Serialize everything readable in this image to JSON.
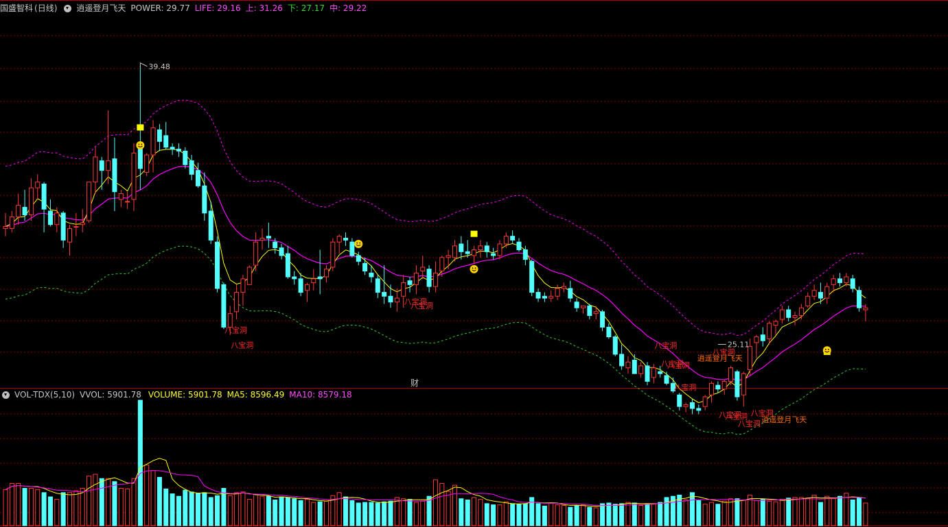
{
  "header": {
    "stock_name": "国盛智科",
    "period": "(日线)",
    "indicator_name": "逍遥登月飞天",
    "power": "POWER: 29.77",
    "life": "LIFE: 29.16",
    "upper": "上: 31.26",
    "lower": "下: 27.17",
    "mid": "中: 29.22"
  },
  "vol_header": {
    "name": "VOL-TDX(5,10)",
    "vvol": "VVOL: 5901.78",
    "volume": "VOLUME: 5901.78",
    "ma5": "MA5: 8596.49",
    "ma10": "MA10: 8579.18"
  },
  "colors": {
    "up": "#ff3a3a",
    "down": "#54ffff",
    "yellow": "#ffff00",
    "magenta": "#ff00ff",
    "green_band": "#33cc33",
    "grid": "#8b0000",
    "header_gray": "#c8c8c8"
  },
  "annotations": {
    "high_label": "39.48",
    "low_label": "25.11",
    "cai_label": "财",
    "signal_a": "八宝洞",
    "signal_b": "逍遥登月飞天"
  },
  "chart_data": {
    "type": "candlestick",
    "price_range": [
      23.5,
      42.2
    ],
    "volume_range": [
      0,
      20500
    ],
    "candles": [
      [
        31.1,
        31.9,
        30.7,
        31.2,
        5900
      ],
      [
        31.1,
        32.0,
        30.9,
        31.7,
        6900
      ],
      [
        31.7,
        32.9,
        31.3,
        32.3,
        6900
      ],
      [
        32.2,
        33.1,
        31.5,
        31.8,
        6100
      ],
      [
        31.8,
        33.7,
        31.5,
        33.2,
        6100
      ],
      [
        33.2,
        33.9,
        32.6,
        33.5,
        5900
      ],
      [
        33.4,
        33.5,
        30.9,
        32.1,
        5400
      ],
      [
        32.0,
        32.6,
        31.2,
        31.3,
        4700
      ],
      [
        31.3,
        32.2,
        30.9,
        31.9,
        4300
      ],
      [
        31.9,
        32.0,
        30.1,
        30.5,
        5400
      ],
      [
        30.4,
        31.3,
        29.7,
        31.1,
        5400
      ],
      [
        31.2,
        31.9,
        30.7,
        31.2,
        5700
      ],
      [
        31.3,
        32.1,
        30.9,
        31.4,
        6100
      ],
      [
        31.5,
        33.5,
        31.4,
        33.5,
        8100
      ],
      [
        33.5,
        35.3,
        32.9,
        34.8,
        8400
      ],
      [
        34.6,
        34.8,
        33.1,
        34.1,
        7700
      ],
      [
        34.1,
        37.2,
        33.4,
        34.6,
        7700
      ],
      [
        34.7,
        35.8,
        32.0,
        33.0,
        7200
      ],
      [
        32.6,
        33.1,
        32.2,
        32.9,
        6100
      ],
      [
        32.5,
        33.0,
        32.1,
        32.5,
        6000
      ],
      [
        32.6,
        35.5,
        32.0,
        35.0,
        7700
      ],
      [
        35.3,
        39.5,
        33.1,
        34.2,
        20500
      ],
      [
        34.0,
        35.0,
        33.8,
        34.9,
        9900
      ],
      [
        34.9,
        36.7,
        34.0,
        36.3,
        9000
      ],
      [
        36.2,
        36.5,
        35.1,
        35.6,
        7900
      ],
      [
        35.9,
        36.6,
        35.2,
        35.3,
        6000
      ],
      [
        35.3,
        35.5,
        34.9,
        35.2,
        5200
      ],
      [
        35.2,
        35.5,
        34.8,
        35.1,
        4800
      ],
      [
        35.1,
        35.3,
        34.2,
        34.4,
        5800
      ],
      [
        34.6,
        34.9,
        33.6,
        33.9,
        5500
      ],
      [
        34.1,
        34.5,
        33.2,
        33.3,
        5300
      ],
      [
        33.3,
        34.0,
        31.5,
        31.9,
        5400
      ],
      [
        32.0,
        32.5,
        30.3,
        30.5,
        4600
      ],
      [
        30.4,
        30.7,
        27.8,
        28.0,
        4900
      ],
      [
        28.2,
        28.3,
        25.9,
        26.0,
        6100
      ],
      [
        26.0,
        27.1,
        25.6,
        26.7,
        4900
      ],
      [
        26.8,
        28.2,
        26.4,
        27.8,
        5400
      ],
      [
        27.8,
        28.7,
        27.1,
        28.5,
        5500
      ],
      [
        28.2,
        29.2,
        28.2,
        29.1,
        4300
      ],
      [
        29.2,
        30.9,
        28.9,
        30.4,
        5100
      ],
      [
        30.5,
        31.1,
        30.0,
        30.6,
        4800
      ],
      [
        30.7,
        31.4,
        30.1,
        30.6,
        4800
      ],
      [
        30.4,
        30.6,
        29.8,
        30.1,
        4200
      ],
      [
        30.1,
        30.3,
        29.5,
        29.7,
        4700
      ],
      [
        29.8,
        30.2,
        28.5,
        28.6,
        4600
      ],
      [
        28.6,
        28.9,
        28.2,
        28.5,
        4400
      ],
      [
        28.5,
        28.8,
        27.6,
        27.8,
        4100
      ],
      [
        27.9,
        28.3,
        27.3,
        28.2,
        4300
      ],
      [
        28.3,
        29.0,
        27.9,
        28.5,
        3800
      ],
      [
        28.6,
        30.0,
        27.7,
        28.5,
        3900
      ],
      [
        28.6,
        29.2,
        28.3,
        29.0,
        4000
      ],
      [
        29.1,
        30.6,
        28.9,
        30.4,
        4900
      ],
      [
        30.4,
        30.8,
        29.8,
        30.7,
        5400
      ],
      [
        30.6,
        30.9,
        30.2,
        30.5,
        4700
      ],
      [
        30.4,
        30.6,
        29.6,
        29.7,
        4100
      ],
      [
        29.7,
        29.9,
        29.2,
        29.4,
        3700
      ],
      [
        29.3,
        29.6,
        28.7,
        28.9,
        3800
      ],
      [
        28.8,
        29.2,
        28.3,
        28.6,
        3800
      ],
      [
        28.5,
        28.7,
        27.5,
        27.8,
        3700
      ],
      [
        27.8,
        29.2,
        27.2,
        27.6,
        3900
      ],
      [
        27.6,
        28.2,
        27.0,
        27.3,
        4000
      ],
      [
        27.3,
        28.0,
        26.8,
        27.5,
        4600
      ],
      [
        27.6,
        28.7,
        27.0,
        28.3,
        4400
      ],
      [
        28.4,
        28.6,
        27.8,
        28.2,
        4300
      ],
      [
        28.2,
        29.2,
        27.7,
        28.8,
        3800
      ],
      [
        28.9,
        29.7,
        28.5,
        29.1,
        4000
      ],
      [
        29.0,
        29.2,
        27.8,
        28.1,
        4800
      ],
      [
        28.1,
        29.4,
        27.8,
        28.8,
        7500
      ],
      [
        28.9,
        29.7,
        28.6,
        29.6,
        6900
      ],
      [
        29.6,
        30.0,
        29.0,
        29.7,
        5600
      ],
      [
        29.6,
        30.5,
        29.4,
        30.2,
        6600
      ],
      [
        30.3,
        30.7,
        29.5,
        29.9,
        4400
      ],
      [
        29.9,
        30.5,
        29.6,
        29.8,
        4200
      ],
      [
        29.7,
        30.2,
        29.3,
        30.0,
        4600
      ],
      [
        30.0,
        30.5,
        29.6,
        30.2,
        4300
      ],
      [
        30.2,
        30.4,
        29.6,
        29.9,
        3600
      ],
      [
        29.8,
        30.1,
        29.5,
        29.7,
        3400
      ],
      [
        29.7,
        30.5,
        29.5,
        30.3,
        3400
      ],
      [
        30.3,
        30.9,
        30.1,
        30.7,
        3900
      ],
      [
        30.7,
        31.0,
        30.3,
        30.5,
        3600
      ],
      [
        30.4,
        30.6,
        29.9,
        30.0,
        3500
      ],
      [
        30.0,
        30.2,
        29.2,
        29.5,
        3600
      ],
      [
        29.4,
        29.5,
        27.6,
        27.8,
        4600
      ],
      [
        27.8,
        28.0,
        27.3,
        27.5,
        3600
      ],
      [
        27.6,
        27.8,
        27.3,
        27.5,
        3200
      ],
      [
        27.5,
        27.9,
        27.3,
        27.6,
        3700
      ],
      [
        27.6,
        28.2,
        27.4,
        28.0,
        3400
      ],
      [
        28.0,
        28.3,
        27.8,
        28.1,
        3300
      ],
      [
        28.0,
        28.4,
        27.3,
        27.5,
        3000
      ],
      [
        27.3,
        27.5,
        26.8,
        27.0,
        3300
      ],
      [
        27.0,
        27.1,
        26.7,
        27.1,
        3400
      ],
      [
        27.1,
        27.2,
        26.4,
        26.6,
        3000
      ],
      [
        26.7,
        27.1,
        26.4,
        26.8,
        2900
      ],
      [
        26.8,
        26.9,
        25.8,
        26.0,
        3600
      ],
      [
        26.0,
        26.2,
        25.4,
        25.5,
        3700
      ],
      [
        25.5,
        25.6,
        24.5,
        24.6,
        3500
      ],
      [
        24.6,
        25.1,
        23.8,
        24.0,
        3600
      ],
      [
        23.9,
        24.5,
        23.6,
        24.2,
        3800
      ],
      [
        24.3,
        24.6,
        23.6,
        23.6,
        3700
      ],
      [
        23.6,
        24.2,
        23.4,
        24.0,
        3300
      ],
      [
        24.0,
        24.2,
        23.0,
        23.2,
        3600
      ],
      [
        23.4,
        24.1,
        23.1,
        23.9,
        3500
      ],
      [
        23.7,
        24.0,
        23.4,
        23.6,
        3800
      ],
      [
        23.5,
        23.7,
        23.0,
        23.1,
        4600
      ],
      [
        23.1,
        23.4,
        22.6,
        22.7,
        4800
      ],
      [
        22.5,
        22.6,
        21.7,
        21.9,
        5000
      ],
      [
        21.9,
        22.1,
        21.6,
        22.0,
        4200
      ],
      [
        22.1,
        22.3,
        21.5,
        21.8,
        5400
      ],
      [
        21.8,
        22.0,
        21.5,
        21.7,
        4100
      ],
      [
        21.9,
        22.5,
        21.7,
        22.4,
        3500
      ],
      [
        22.5,
        23.2,
        22.1,
        23.1,
        3800
      ],
      [
        23.0,
        23.2,
        22.6,
        22.8,
        3500
      ],
      [
        22.8,
        23.3,
        22.5,
        23.2,
        4000
      ],
      [
        23.2,
        24.0,
        23.0,
        23.9,
        4400
      ],
      [
        23.7,
        23.8,
        22.2,
        22.4,
        4400
      ],
      [
        22.5,
        23.7,
        21.9,
        23.6,
        4200
      ],
      [
        23.8,
        25.4,
        23.5,
        25.0,
        5000
      ],
      [
        25.2,
        25.6,
        24.4,
        25.5,
        4100
      ],
      [
        25.6,
        26.0,
        25.0,
        25.3,
        4300
      ],
      [
        25.4,
        26.3,
        25.1,
        26.2,
        4000
      ],
      [
        26.1,
        26.4,
        25.6,
        26.3,
        3900
      ],
      [
        26.4,
        27.1,
        26.2,
        26.9,
        4300
      ],
      [
        26.9,
        27.1,
        26.3,
        26.5,
        4500
      ],
      [
        26.5,
        26.8,
        26.1,
        26.6,
        4600
      ],
      [
        26.6,
        27.2,
        26.4,
        27.0,
        4600
      ],
      [
        27.1,
        27.8,
        27.0,
        27.6,
        4500
      ],
      [
        27.6,
        28.2,
        27.4,
        27.9,
        5000
      ],
      [
        27.8,
        28.3,
        27.2,
        27.5,
        3800
      ],
      [
        27.5,
        28.3,
        27.2,
        28.1,
        4800
      ],
      [
        28.2,
        28.7,
        27.8,
        28.5,
        4400
      ],
      [
        28.5,
        28.8,
        28.1,
        28.3,
        4800
      ],
      [
        28.3,
        28.8,
        28.1,
        28.6,
        5300
      ],
      [
        28.5,
        28.7,
        27.8,
        28.0,
        4200
      ],
      [
        27.9,
        28.1,
        26.8,
        27.0,
        4500
      ],
      [
        26.9,
        27.2,
        26.3,
        27.0,
        3700
      ]
    ]
  }
}
